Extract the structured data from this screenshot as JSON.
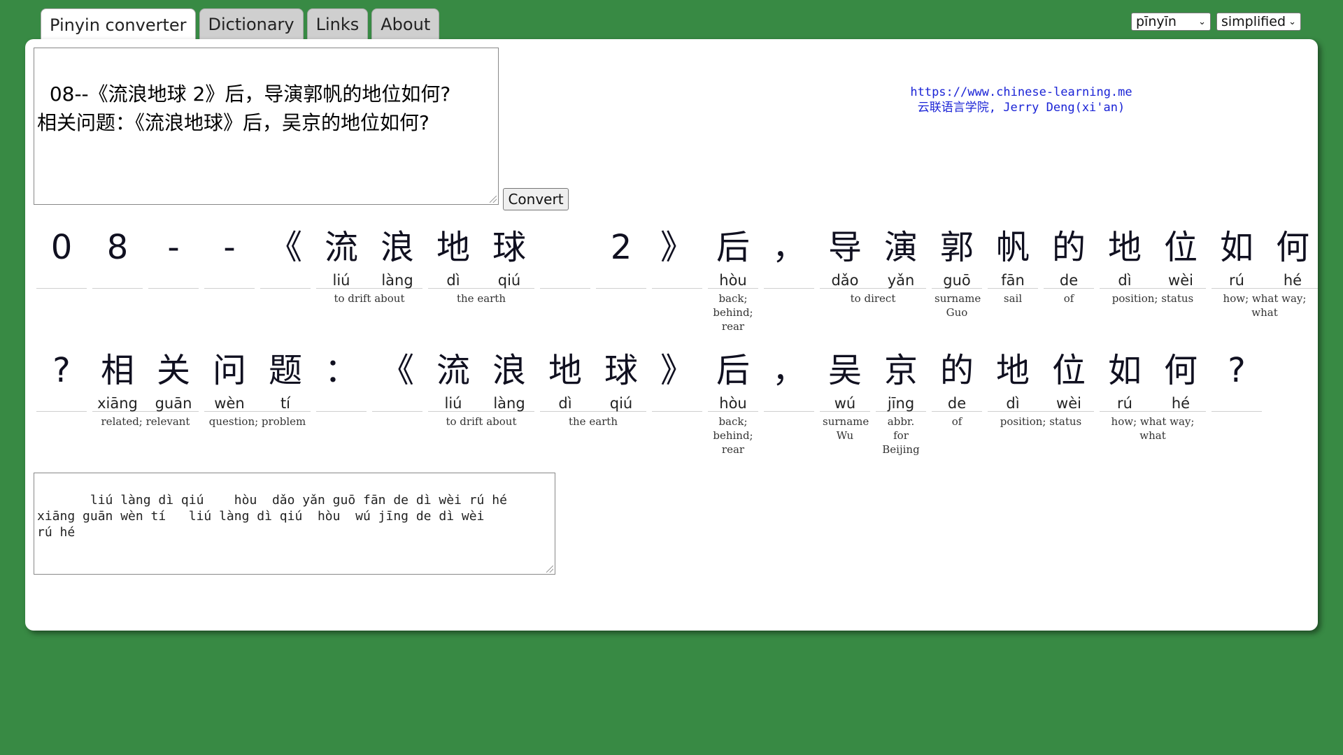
{
  "tabs": [
    {
      "label": "Pinyin converter",
      "active": true
    },
    {
      "label": "Dictionary",
      "active": false
    },
    {
      "label": "Links",
      "active": false
    },
    {
      "label": "About",
      "active": false
    }
  ],
  "selects": {
    "romanization": "pīnyīn",
    "script": "simplified"
  },
  "input_text": "08--《流浪地球 2》后，导演郭帆的地位如何?\n相关问题：《流浪地球》后，吴京的地位如何?",
  "convert_label": "Convert",
  "site": {
    "url": "https://www.chinese-learning.me",
    "org": "云联语言学院, Jerry Deng(xi'an)"
  },
  "rows": [
    {
      "groups": [
        {
          "chars": [
            {
              "hz": "0",
              "py": ""
            }
          ],
          "def": ""
        },
        {
          "chars": [
            {
              "hz": "8",
              "py": ""
            }
          ],
          "def": ""
        },
        {
          "chars": [
            {
              "hz": "-",
              "py": ""
            }
          ],
          "def": ""
        },
        {
          "chars": [
            {
              "hz": "-",
              "py": ""
            }
          ],
          "def": ""
        },
        {
          "chars": [
            {
              "hz": "《",
              "py": ""
            }
          ],
          "def": ""
        },
        {
          "chars": [
            {
              "hz": "流",
              "py": "liú"
            },
            {
              "hz": "浪",
              "py": "làng"
            }
          ],
          "def": "to drift about"
        },
        {
          "chars": [
            {
              "hz": "地",
              "py": "dì"
            },
            {
              "hz": "球",
              "py": "qiú"
            }
          ],
          "def": "the earth"
        },
        {
          "chars": [
            {
              "hz": "",
              "py": ""
            }
          ],
          "def": ""
        },
        {
          "chars": [
            {
              "hz": "2",
              "py": ""
            }
          ],
          "def": ""
        },
        {
          "chars": [
            {
              "hz": "》",
              "py": ""
            }
          ],
          "def": ""
        },
        {
          "chars": [
            {
              "hz": "后",
              "py": "hòu"
            }
          ],
          "def": "back; behind; rear"
        },
        {
          "chars": [
            {
              "hz": "，",
              "py": ""
            }
          ],
          "def": ""
        },
        {
          "chars": [
            {
              "hz": "导",
              "py": "dǎo"
            },
            {
              "hz": "演",
              "py": "yǎn"
            }
          ],
          "def": "to direct"
        },
        {
          "chars": [
            {
              "hz": "郭",
              "py": "guō"
            }
          ],
          "def": "surname Guo"
        },
        {
          "chars": [
            {
              "hz": "帆",
              "py": "fān"
            }
          ],
          "def": "sail"
        },
        {
          "chars": [
            {
              "hz": "的",
              "py": "de"
            }
          ],
          "def": "of"
        },
        {
          "chars": [
            {
              "hz": "地",
              "py": "dì"
            },
            {
              "hz": "位",
              "py": "wèi"
            }
          ],
          "def": "position; status"
        },
        {
          "chars": [
            {
              "hz": "如",
              "py": "rú"
            },
            {
              "hz": "何",
              "py": "hé"
            }
          ],
          "def": "how; what way; what"
        }
      ]
    },
    {
      "groups": [
        {
          "chars": [
            {
              "hz": "?",
              "py": ""
            }
          ],
          "def": ""
        },
        {
          "chars": [
            {
              "hz": "相",
              "py": "xiāng"
            },
            {
              "hz": "关",
              "py": "guān"
            }
          ],
          "def": "related; relevant"
        },
        {
          "chars": [
            {
              "hz": "问",
              "py": "wèn"
            },
            {
              "hz": "题",
              "py": "tí"
            }
          ],
          "def": "question; problem"
        },
        {
          "chars": [
            {
              "hz": "：",
              "py": ""
            }
          ],
          "def": ""
        },
        {
          "chars": [
            {
              "hz": "《",
              "py": ""
            }
          ],
          "def": ""
        },
        {
          "chars": [
            {
              "hz": "流",
              "py": "liú"
            },
            {
              "hz": "浪",
              "py": "làng"
            }
          ],
          "def": "to drift about"
        },
        {
          "chars": [
            {
              "hz": "地",
              "py": "dì"
            },
            {
              "hz": "球",
              "py": "qiú"
            }
          ],
          "def": "the earth"
        },
        {
          "chars": [
            {
              "hz": "》",
              "py": ""
            }
          ],
          "def": ""
        },
        {
          "chars": [
            {
              "hz": "后",
              "py": "hòu"
            }
          ],
          "def": "back; behind; rear"
        },
        {
          "chars": [
            {
              "hz": "，",
              "py": ""
            }
          ],
          "def": ""
        },
        {
          "chars": [
            {
              "hz": "吴",
              "py": "wú"
            }
          ],
          "def": "surname Wu"
        },
        {
          "chars": [
            {
              "hz": "京",
              "py": "jīng"
            }
          ],
          "def": "abbr. for Beijing"
        },
        {
          "chars": [
            {
              "hz": "的",
              "py": "de"
            }
          ],
          "def": "of"
        },
        {
          "chars": [
            {
              "hz": "地",
              "py": "dì"
            },
            {
              "hz": "位",
              "py": "wèi"
            }
          ],
          "def": "position; status"
        },
        {
          "chars": [
            {
              "hz": "如",
              "py": "rú"
            },
            {
              "hz": "何",
              "py": "hé"
            }
          ],
          "def": "how; what way; what"
        },
        {
          "chars": [
            {
              "hz": "?",
              "py": ""
            }
          ],
          "def": ""
        }
      ]
    }
  ],
  "output_text": "     liú làng dì qiú    hòu  dǎo yǎn guō fān de dì wèi rú hé\nxiāng guān wèn tí   liú làng dì qiú  hòu  wú jīng de dì wèi\nrú hé"
}
